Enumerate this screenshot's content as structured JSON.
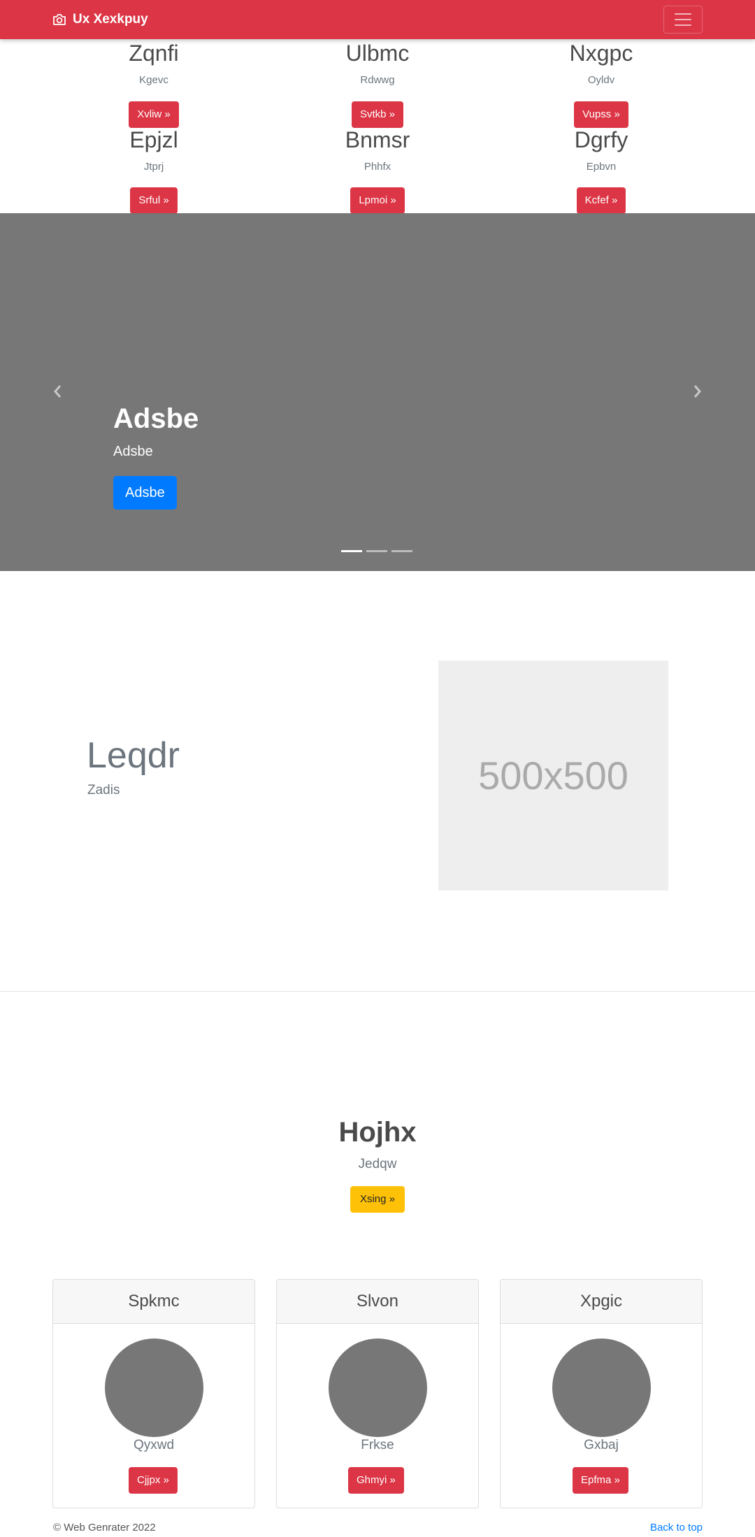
{
  "navbar": {
    "brand": "Ux Xexkpuy",
    "brand_icon": "camera-icon",
    "toggler_icon": "hamburger-icon",
    "bg_color": "#dc3545"
  },
  "products": [
    {
      "title": "Zqnfi",
      "subtitle": "Kgevc",
      "button": "Xvliw »"
    },
    {
      "title": "Ulbmc",
      "subtitle": "Rdwwg",
      "button": "Svtkb »"
    },
    {
      "title": "Nxgpc",
      "subtitle": "Oyldv",
      "button": "Vupss »"
    },
    {
      "title": "Epjzl",
      "subtitle": "Jtprj",
      "button": "Srful »"
    },
    {
      "title": "Bnmsr",
      "subtitle": "Phhfx",
      "button": "Lpmoi »"
    },
    {
      "title": "Dgrfy",
      "subtitle": "Epbvn",
      "button": "Kcfef »"
    }
  ],
  "carousel": {
    "title": "Adsbe",
    "subtitle": "Adsbe",
    "button": "Adsbe",
    "prev_icon": "chevron-left-icon",
    "next_icon": "chevron-right-icon",
    "slide_count": 3,
    "active_slide": 1
  },
  "feature": {
    "heading": "Leqdr",
    "subheading": "Zadis",
    "image_label": "500x500"
  },
  "section": {
    "title": "Hojhx",
    "subtitle": "Jedqw",
    "button": "Xsing »"
  },
  "cards": [
    {
      "header": "Spkmc",
      "name": "Qyxwd",
      "button": "Cjjpx »"
    },
    {
      "header": "Slvon",
      "name": "Frkse",
      "button": "Ghmyi »"
    },
    {
      "header": "Xpgic",
      "name": "Gxbaj",
      "button": "Epfma »"
    }
  ],
  "footer": {
    "copyright": "© Web Genrater 2022",
    "back_to_top": "Back to top"
  }
}
